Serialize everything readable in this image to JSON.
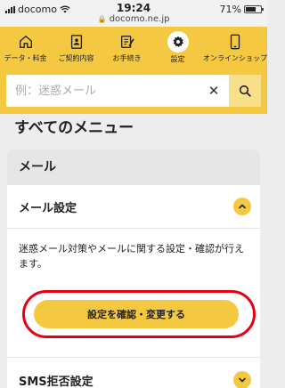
{
  "status_bar": {
    "carrier": "docomo",
    "time": "19:24",
    "url": "docomo.ne.jp",
    "battery": "71%",
    "battery_level": 0.71
  },
  "nav": {
    "items": [
      {
        "label": "データ・料金",
        "icon": "house-icon"
      },
      {
        "label": "ご契約内容",
        "icon": "contract-icon"
      },
      {
        "label": "お手続き",
        "icon": "pen-doc-icon"
      },
      {
        "label": "設定",
        "icon": "gear-icon",
        "active": true
      },
      {
        "label": "オンラインショップ",
        "icon": "smartphone-icon"
      }
    ]
  },
  "search": {
    "placeholder": "例：迷惑メール",
    "clear_icon": "close-icon",
    "submit_icon": "search-icon"
  },
  "page": {
    "title": "すべてのメニュー"
  },
  "section": {
    "title": "メール",
    "mail_settings": {
      "label": "メール設定",
      "description": "迷惑メール対策やメールに関する設定・確認が行えます。",
      "button": "設定を確認・変更する",
      "expanded": true
    },
    "sms": {
      "label": "SMS拒否設定",
      "expanded": false
    }
  },
  "colors": {
    "brand_yellow": "#f5c842",
    "highlight_red": "#e60012"
  }
}
